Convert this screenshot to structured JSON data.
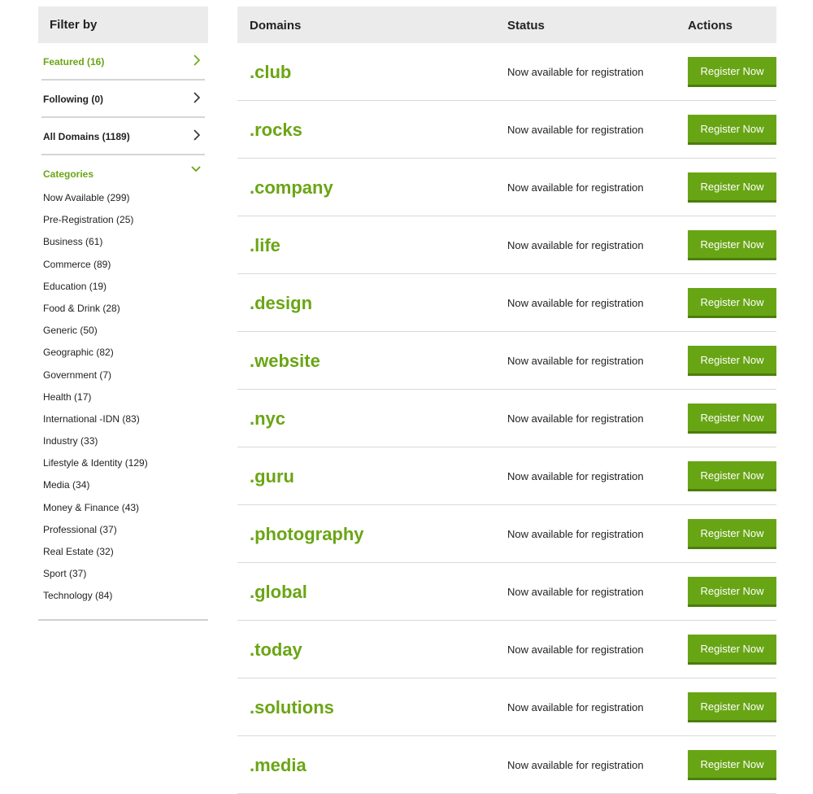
{
  "sidebar": {
    "title": "Filter by",
    "filters": [
      {
        "label": "Featured (16)",
        "active": true
      },
      {
        "label": "Following (0)",
        "active": false
      },
      {
        "label": "All Domains (1189)",
        "active": false
      }
    ],
    "categories_label": "Categories",
    "categories": [
      "Now Available (299)",
      "Pre-Registration (25)",
      "Business (61)",
      "Commerce (89)",
      "Education (19)",
      "Food & Drink (28)",
      "Generic (50)",
      "Geographic (82)",
      "Government (7)",
      "Health (17)",
      "International -IDN (83)",
      "Industry (33)",
      "Lifestyle & Identity (129)",
      "Media (34)",
      "Money & Finance (43)",
      "Professional (37)",
      "Real Estate (32)",
      "Sport (37)",
      "Technology (84)"
    ]
  },
  "table": {
    "headers": {
      "domains": "Domains",
      "status": "Status",
      "actions": "Actions"
    },
    "rows": [
      {
        "domain": ".club",
        "status": "Now available for registration",
        "action": "Register Now"
      },
      {
        "domain": ".rocks",
        "status": "Now available for registration",
        "action": "Register Now"
      },
      {
        "domain": ".company",
        "status": "Now available for registration",
        "action": "Register Now"
      },
      {
        "domain": ".life",
        "status": "Now available for registration",
        "action": "Register Now"
      },
      {
        "domain": ".design",
        "status": "Now available for registration",
        "action": "Register Now"
      },
      {
        "domain": ".website",
        "status": "Now available for registration",
        "action": "Register Now"
      },
      {
        "domain": ".nyc",
        "status": "Now available for registration",
        "action": "Register Now"
      },
      {
        "domain": ".guru",
        "status": "Now available for registration",
        "action": "Register Now"
      },
      {
        "domain": ".photography",
        "status": "Now available for registration",
        "action": "Register Now"
      },
      {
        "domain": ".global",
        "status": "Now available for registration",
        "action": "Register Now"
      },
      {
        "domain": ".today",
        "status": "Now available for registration",
        "action": "Register Now"
      },
      {
        "domain": ".solutions",
        "status": "Now available for registration",
        "action": "Register Now"
      },
      {
        "domain": ".media",
        "status": "Now available for registration",
        "action": "Register Now"
      }
    ]
  },
  "colors": {
    "accent": "#6aa514",
    "button": "#68a515",
    "header_bg": "#ebebeb"
  },
  "icons": {
    "filter_chevron": "chevron-right-icon",
    "categories_chevron": "chevron-down-icon"
  }
}
